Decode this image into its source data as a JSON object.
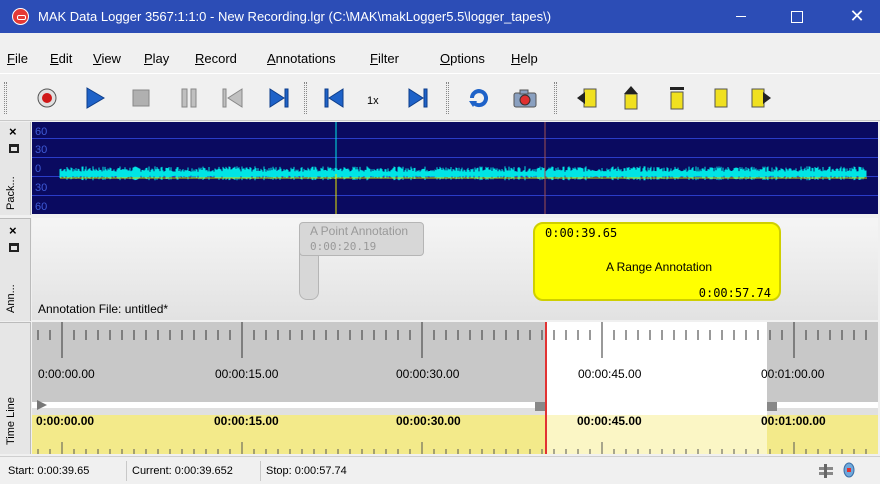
{
  "window": {
    "title": "MAK Data Logger 3567:1:1:0 - New Recording.lgr (C:\\MAK\\makLogger5.5\\logger_tapes\\)",
    "close_glyph": "✕"
  },
  "menu": [
    {
      "label": "File",
      "key": "F",
      "rest": "ile"
    },
    {
      "label": "Edit",
      "key": "E",
      "rest": "dit"
    },
    {
      "label": "View",
      "key": "V",
      "rest": "iew"
    },
    {
      "label": "Play",
      "key": "P",
      "rest": "lay"
    },
    {
      "label": "Record",
      "key": "R",
      "rest": "ecord"
    },
    {
      "label": "Annotations",
      "key": "A",
      "rest": "nnotations"
    },
    {
      "label": "Filter",
      "key": "F",
      "rest": "ilter"
    },
    {
      "label": "Options",
      "key": "O",
      "rest": "ptions"
    },
    {
      "label": "Help",
      "key": "H",
      "rest": "elp"
    }
  ],
  "toolbar": {
    "speed": "1x",
    "icons": [
      "record-icon",
      "play-icon",
      "stop-icon",
      "pause-icon",
      "rewind-icon",
      "fast-forward-icon",
      "step-back-icon",
      "step-forward-icon",
      "loop-icon",
      "snapshot-icon",
      "annotation-prev-icon",
      "annotation-up-icon",
      "annotation-top-icon",
      "annotation-down-icon",
      "annotation-next-icon"
    ]
  },
  "packets": {
    "panel_label": "Pack...",
    "close_glyph": "×",
    "scale_labels": [
      "60",
      "30",
      "0",
      "30",
      "60"
    ]
  },
  "annotations": {
    "panel_label": "Ann...",
    "close_glyph": "×",
    "point": {
      "name": "A Point Annotation",
      "time": "0:00:20.19"
    },
    "range": {
      "name": "A Range Annotation",
      "start": "0:00:39.65",
      "stop": "0:00:57.74"
    },
    "file_label": "Annotation File: untitled*"
  },
  "timeline": {
    "panel_label": "Time Line",
    "top_labels": [
      "0:00:00.00",
      "00:00:15.00",
      "00:00:30.00",
      "00:00:45.00",
      "00:01:00.00"
    ],
    "bottom_labels": [
      "0:00:00.00",
      "00:00:15.00",
      "00:00:30.00",
      "00:00:45.00",
      "00:01:00.00"
    ]
  },
  "status": {
    "start": "Start: 0:00:39.65",
    "current": "Current: 0:00:39.652",
    "stop": "Stop: 0:00:57.74"
  },
  "colors": {
    "titlebar": "#2c4db6",
    "range_annotation": "#ffff00",
    "waveform": "#00e5e5",
    "marker": "#e23333"
  }
}
